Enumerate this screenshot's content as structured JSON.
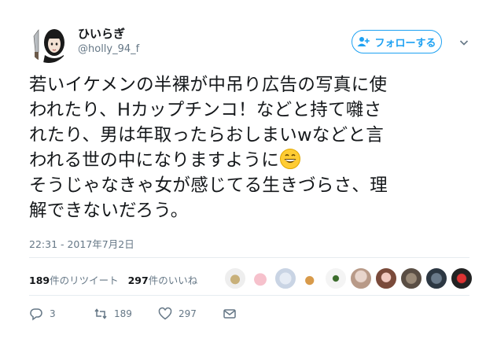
{
  "user": {
    "name": "ひいらぎ",
    "handle": "@holly_94_f"
  },
  "follow_label": "フォローする",
  "tweet": {
    "text": "若いイケメンの半裸が中吊り広告の写真に使\nわれたり、Hカップチンコ！などと持て囃さ\nれたり、男は年取ったらおしまいwなどと言\nわれる世の中になりますように",
    "text_tail": "\nそうじゃなきゃ女が感じてる生きづらさ、理\n解できないだろう。",
    "timestamp": "22:31 - 2017年7月2日"
  },
  "stats": {
    "retweet_count": "189",
    "retweet_label": "件のリツイート",
    "like_count": "297",
    "like_label": "件のいいね"
  },
  "actions": {
    "reply_count": "3",
    "retweet_count": "189",
    "like_count": "297"
  },
  "colors": {
    "accent": "#1da1f2",
    "muted": "#657786",
    "text": "#14171a"
  }
}
